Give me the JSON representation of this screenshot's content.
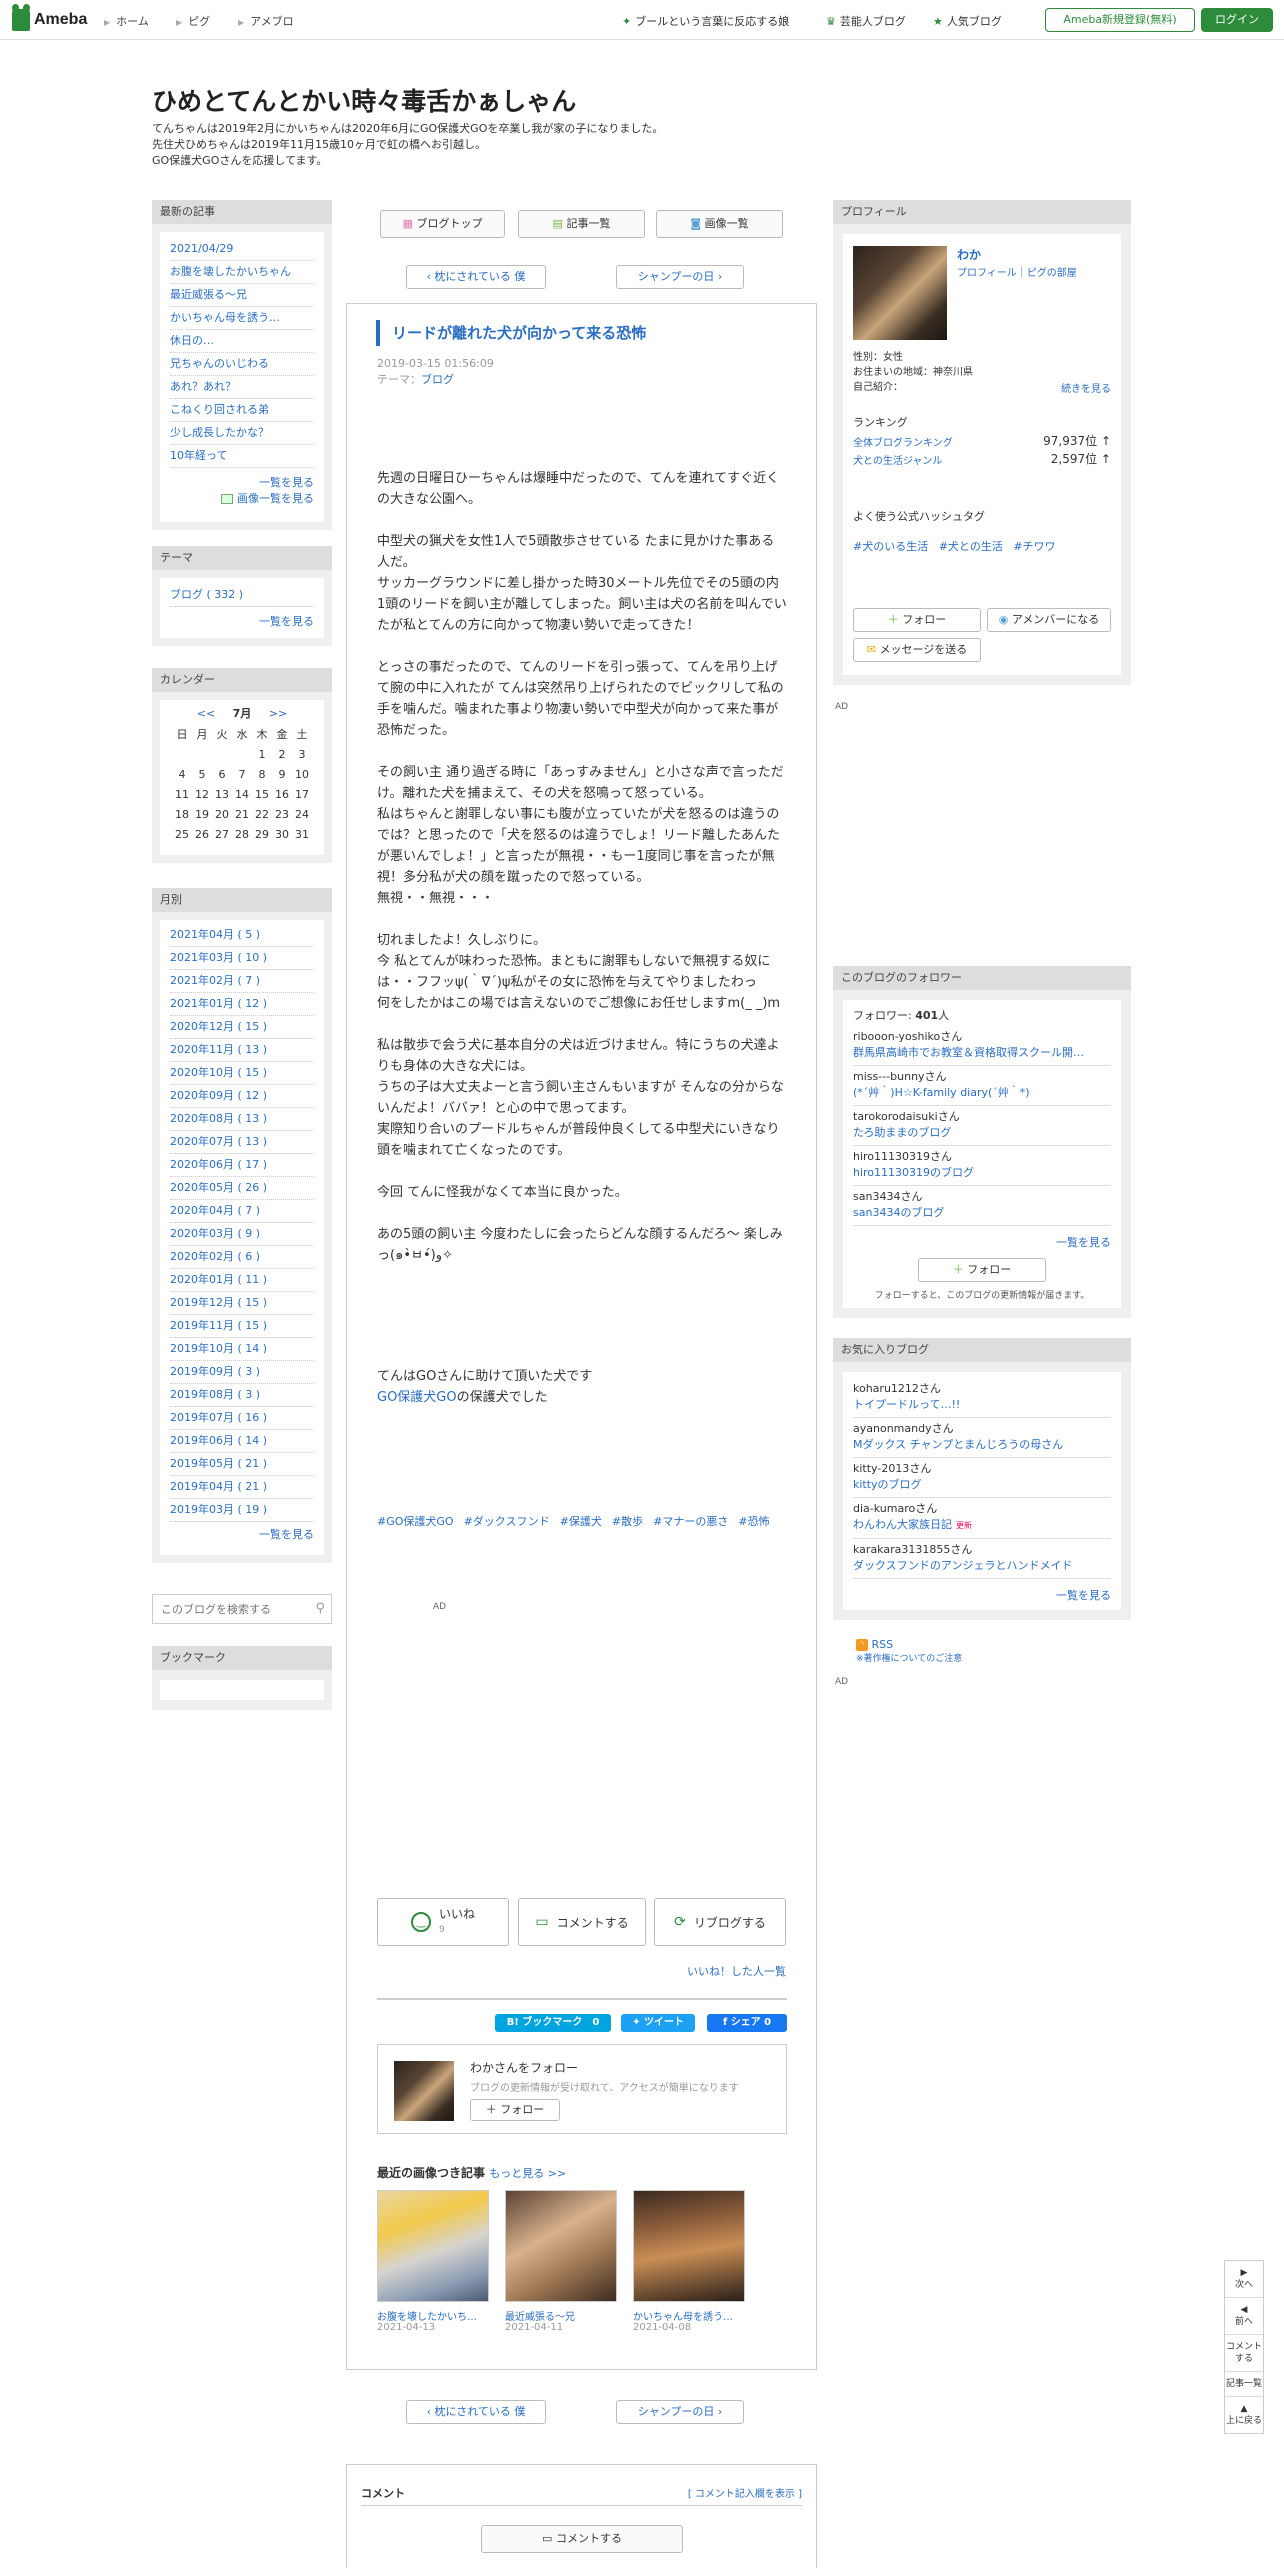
{
  "nav": {
    "logo": "Ameba",
    "links": [
      "ホーム",
      "ピグ",
      "アメブロ"
    ],
    "right_links": [
      "ブールという言葉に反応する娘",
      "芸能人ブログ",
      "人気ブログ"
    ],
    "register": "Ameba新規登録(無料)",
    "login": "ログイン"
  },
  "blog": {
    "title": "ひめとてんとかい時々毒舌かぁしゃん",
    "desc": [
      "てんちゃんは2019年2月にかいちゃんは2020年6月にGO保護犬GOを卒業し我が家の子になりました。",
      "先住犬ひめちゃんは2019年11月15歳10ヶ月で虹の橋へお引越し。",
      "GO保護犬GOさんを応援してます。"
    ]
  },
  "recent": {
    "header": "最新の記事",
    "items": [
      "2021/04/29",
      "お腹を壊したかいちゃん",
      "最近威張る〜兄",
      "かいちゃん母を誘う…",
      "休日の…",
      "兄ちゃんのいじわる",
      "あれ？あれ？",
      "こねくり回される弟",
      "少し成長したかな？",
      "10年経って"
    ],
    "more": "一覧を見る",
    "images": "画像一覧を見る"
  },
  "theme": {
    "header": "テーマ",
    "item": "ブログ ( 332 )",
    "more": "一覧を見る"
  },
  "calendar": {
    "header": "カレンダー",
    "prev": "<<",
    "month": "7月",
    "next": ">>",
    "weekdays": [
      "日",
      "月",
      "火",
      "水",
      "木",
      "金",
      "土"
    ],
    "weeks": [
      [
        "",
        "",
        "",
        "",
        "1",
        "2",
        "3"
      ],
      [
        "4",
        "5",
        "6",
        "7",
        "8",
        "9",
        "10"
      ],
      [
        "11",
        "12",
        "13",
        "14",
        "15",
        "16",
        "17"
      ],
      [
        "18",
        "19",
        "20",
        "21",
        "22",
        "23",
        "24"
      ],
      [
        "25",
        "26",
        "27",
        "28",
        "29",
        "30",
        "31"
      ]
    ]
  },
  "monthly": {
    "header": "月別",
    "items": [
      "2021年04月 ( 5 )",
      "2021年03月 ( 10 )",
      "2021年02月 ( 7 )",
      "2021年01月 ( 12 )",
      "2020年12月 ( 15 )",
      "2020年11月 ( 13 )",
      "2020年10月 ( 15 )",
      "2020年09月 ( 12 )",
      "2020年08月 ( 13 )",
      "2020年07月 ( 13 )",
      "2020年06月 ( 17 )",
      "2020年05月 ( 26 )",
      "2020年04月 ( 7 )",
      "2020年03月 ( 9 )",
      "2020年02月 ( 6 )",
      "2020年01月 ( 11 )",
      "2019年12月 ( 15 )",
      "2019年11月 ( 15 )",
      "2019年10月 ( 14 )",
      "2019年09月 ( 3 )",
      "2019年08月 ( 3 )",
      "2019年07月 ( 16 )",
      "2019年06月 ( 14 )",
      "2019年05月 ( 21 )",
      "2019年04月 ( 21 )",
      "2019年03月 ( 19 )"
    ],
    "more": "一覧を見る"
  },
  "search": {
    "placeholder": "このブログを検索する"
  },
  "bookmark": {
    "header": "ブックマーク"
  },
  "center": {
    "top_buttons": [
      "ブログトップ",
      "記事一覧",
      "画像一覧"
    ],
    "prev": "枕にされている 僕",
    "next": "シャンプーの日",
    "entry_title": "リードが離れた犬が向かって来る恐怖",
    "date": "2019-03-15 01:56:09",
    "theme_label": "テーマ：",
    "theme": "ブログ",
    "paragraphs": [
      [
        "先週の日曜日ひーちゃんは爆睡中だったので、てんを連れてすぐ近くの大きな公園へ。"
      ],
      [
        "中型犬の猟犬を女性1人で5頭散歩させている たまに見かけた事ある人だ。",
        "サッカーグラウンドに差し掛かった時30メートル先位でその5頭の内1頭のリードを飼い主が離してしまった。飼い主は犬の名前を叫んでいたが私とてんの方に向かって物凄い勢いで走ってきた！"
      ],
      [
        "とっさの事だったので、てんのリードを引っ張って、てんを吊り上げて腕の中に入れたが てんは突然吊り上げられたのでビックリして私の手を噛んだ。噛まれた事より物凄い勢いで中型犬が向かって来た事が恐怖だった。"
      ],
      [
        "その飼い主 通り過ぎる時に「あっすみません」と小さな声で言っただけ。離れた犬を捕まえて、その犬を怒鳴って怒っている。",
        "私はちゃんと謝罪しない事にも腹が立っていたが犬を怒るのは違うのでは？と思ったので「犬を怒るのは違うでしょ！リード離したあんたが悪いんでしょ！」と言ったが無視・・もー1度同じ事を言ったが無視！多分私が犬の顔を蹴ったので怒っている。",
        "無視・・無視・・・"
      ],
      [
        "切れましたよ！久しぶりに。",
        "今 私とてんが味わった恐怖。まともに謝罪もしないで無視する奴には・・フフッψ(｀∇´)ψ私がその女に恐怖を与えてやりましたわっ",
        "何をしたかはこの場では言えないのでご想像にお任せしますm(_ _)m"
      ],
      [
        "私は散歩で会う犬に基本自分の犬は近づけません。特にうちの犬達よりも身体の大きな犬には。",
        "うちの子は大丈夫よーと言う飼い主さんもいますが そんなの分からないんだよ！ババァ！と心の中で思ってます。",
        "実際知り合いのプードルちゃんが普段仲良くしてる中型犬にいきなり頭を噛まれて亡くなったのです。"
      ],
      [
        "今回 てんに怪我がなくて本当に良かった。"
      ],
      [
        "あの5頭の飼い主 今度わたしに会ったらどんな顔するんだろ〜 楽しみっ(๑•̀ㅂ•́)و✧"
      ]
    ],
    "closing1": "てんはGOさんに助けて頂いた犬です",
    "closing_link": "GO保護犬GO",
    "closing2": "の保護犬でした",
    "tags": [
      "#GO保護犬GO",
      "#ダックスフンド",
      "#保護犬",
      "#散歩",
      "#マナーの悪さ",
      "#恐怖"
    ],
    "ad": "AD",
    "like": "いいね",
    "like_count": "9",
    "comment": "コメントする",
    "reblog": "リブログする",
    "liked_link": "いいね！した人一覧",
    "hatena": "B! ブックマーク　0",
    "tweet": "ツイート",
    "share": "シェア 0",
    "follow_title": "わかさんをフォロー",
    "follow_desc": "ブログの更新情報が受け取れて、アクセスが簡単になります",
    "follow_btn": "＋ フォロー",
    "recent_images": "最近の画像つき記事",
    "recent_more": "もっと見る >>",
    "thumbs": [
      {
        "title": "お腹を壊したかいち…",
        "date": "2021-04-13"
      },
      {
        "title": "最近威張る〜兄",
        "date": "2021-04-11"
      },
      {
        "title": "かいちゃん母を誘う…",
        "date": "2021-04-08"
      }
    ],
    "comment_header": "コメント",
    "comment_show": "[ コメント記入欄を表示 ]",
    "comment_btn": "コメントする"
  },
  "profile": {
    "header": "プロフィール",
    "name": "わか",
    "links": "プロフィール｜ピグの部屋",
    "gender": "性別：女性",
    "area": "お住まいの地域：神奈川県",
    "intro": "自己紹介：",
    "intro_more": "続きを見る",
    "ranking": "ランキング",
    "rank1_label": "全体ブログランキング",
    "rank1_value": "97,937位 ↑",
    "rank2_label": "犬との生活ジャンル",
    "rank2_value": "2,597位 ↑",
    "hashtag_title": "よく使う公式ハッシュタグ",
    "hashtags": [
      "#犬のいる生活",
      "#犬との生活",
      "#チワワ"
    ],
    "follow": "フォロー",
    "member": "アメンバーになる",
    "message": "メッセージを送る",
    "ad": "AD"
  },
  "followers": {
    "header": "このブログのフォロワー",
    "count_label": "フォロワー:",
    "count": "401",
    "count_suffix": "人",
    "items": [
      {
        "user": "ribooon-yoshikoさん",
        "blog": "群馬県高崎市でお教室＆資格取得スクール開…"
      },
      {
        "user": "miss---bunnyさん",
        "blog": "(*´艸｀)H☆K-family diary(´艸｀*)"
      },
      {
        "user": "tarokorodaisukiさん",
        "blog": "たろ助ままのブログ"
      },
      {
        "user": "hiro11130319さん",
        "blog": "hiro11130319のブログ"
      },
      {
        "user": "san3434さん",
        "blog": "san3434のブログ"
      }
    ],
    "more": "一覧を見る",
    "follow": "フォロー",
    "note": "フォローすると、このブログの更新情報が届きます。"
  },
  "favorites": {
    "header": "お気に入りブログ",
    "items": [
      {
        "user": "koharu1212さん",
        "blog": "トイプードルって…!!"
      },
      {
        "user": "ayanonmandyさん",
        "blog": "Mダックス チャンプとまんじろうの母さん"
      },
      {
        "user": "kitty-2013さん",
        "blog": "kittyのブログ"
      },
      {
        "user": "dia-kumaroさん",
        "blog": "わんわん大家族日記",
        "badge": "更新"
      },
      {
        "user": "karakara3131855さん",
        "blog": "ダックスフンドのアンジェラとハンドメイド"
      }
    ],
    "more": "一覧を見る"
  },
  "rss": {
    "label": "RSS",
    "note": "※著作権についてのご注意",
    "ad": "AD"
  },
  "sidenav": [
    "次へ",
    "前へ",
    "コメントする",
    "記事一覧",
    "上に戻る"
  ],
  "colors": {
    "brand": "#2d8c3c",
    "link": "#2a6ec3",
    "hatena": "#00a4de",
    "twitter": "#1da1f2",
    "facebook": "#1877f2"
  }
}
